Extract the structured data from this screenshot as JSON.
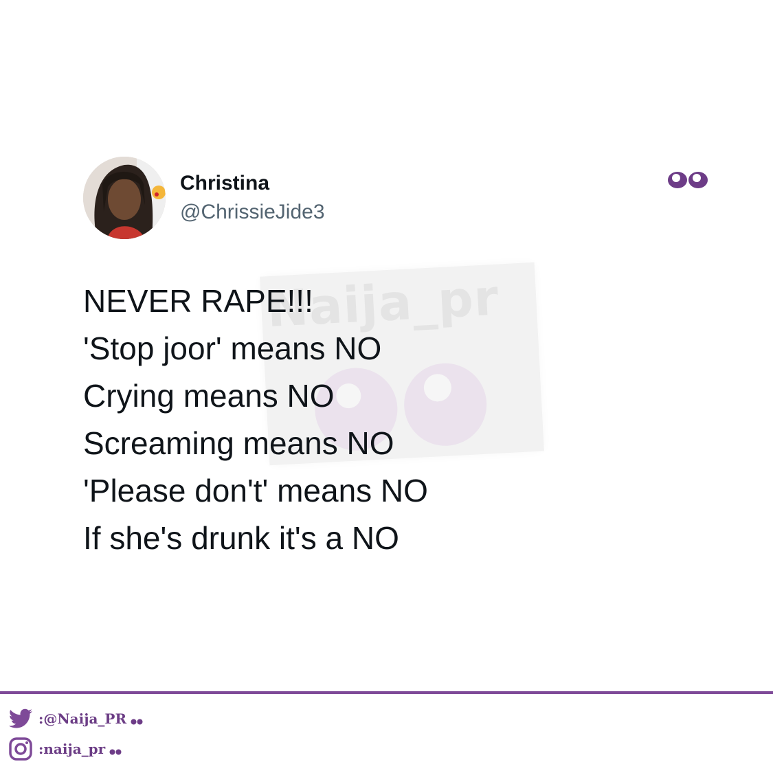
{
  "tweet": {
    "author_name": "Christina",
    "author_handle": "@ChrissieJide3",
    "lines": [
      "NEVER RAPE!!!",
      "'Stop joor' means NO",
      "Crying means NO",
      "Screaming means NO",
      "'Please don't' means NO",
      "If she's drunk it's a NO"
    ]
  },
  "watermark": {
    "text": "Naija_pr"
  },
  "footer": {
    "twitter_handle": ":@Naija_PR",
    "instagram_handle": ":naija_pr"
  },
  "colors": {
    "brand_purple": "#7e4a98",
    "text_primary": "#0f1419",
    "text_secondary": "#536471"
  },
  "icons": {
    "header_right": "eyes-icon",
    "footer_twitter": "twitter-bird-icon",
    "footer_instagram": "instagram-icon"
  }
}
